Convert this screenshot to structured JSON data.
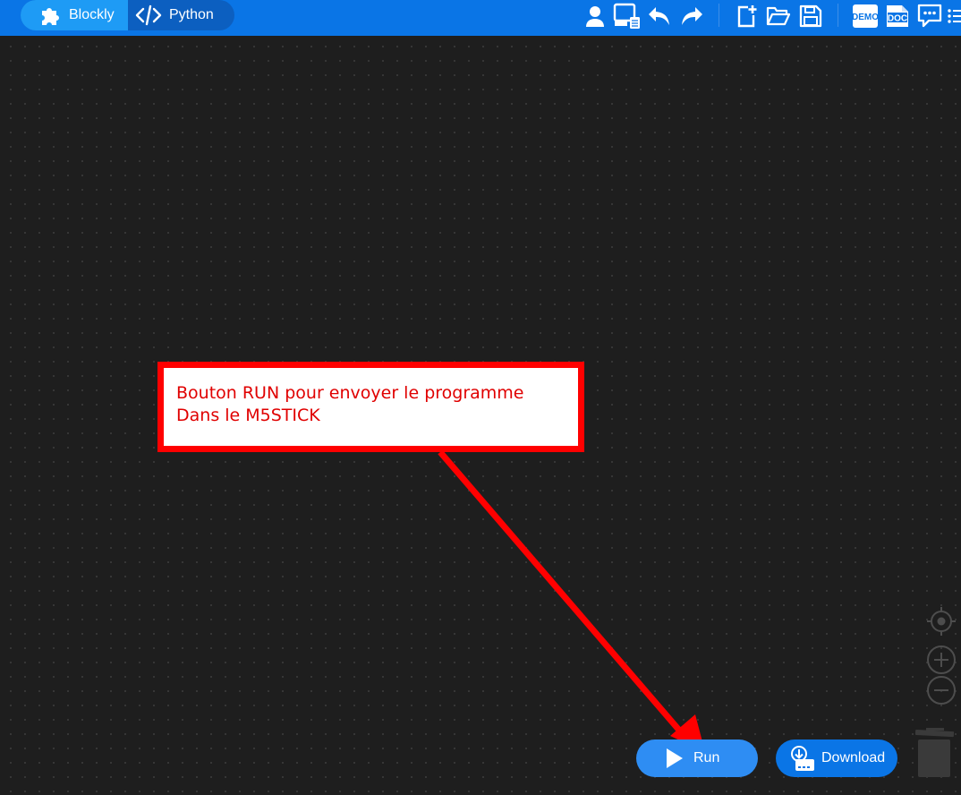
{
  "header": {
    "modes": [
      {
        "label": "Blockly",
        "icon": "puzzle-icon",
        "active": true
      },
      {
        "label": "Python",
        "icon": "code-icon",
        "active": false
      }
    ],
    "toolbar_icons": [
      "user-icon",
      "device-icon",
      "undo-icon",
      "redo-icon",
      "new-file-icon",
      "open-folder-icon",
      "save-icon",
      "demo-icon",
      "doc-icon",
      "feedback-icon",
      "menu-icon"
    ],
    "demo_label": "DEMO",
    "doc_label": "DOC"
  },
  "annotation": {
    "line1": "Bouton RUN pour envoyer le programme",
    "line2": "Dans le M5STICK",
    "color": "#ff0000"
  },
  "actions": {
    "run_label": "Run",
    "download_label": "Download"
  },
  "workspace_controls": [
    "recenter-icon",
    "zoom-in-icon",
    "zoom-out-icon",
    "trash-icon"
  ],
  "colors": {
    "topbar": "#0a75e6",
    "active_mode": "#1e9bf5",
    "run_button": "#2e8df3",
    "workspace": "#1e1e1e"
  }
}
